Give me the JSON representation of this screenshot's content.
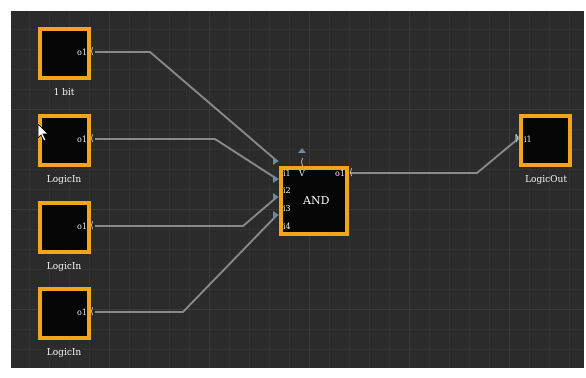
{
  "nodes": {
    "in1": {
      "caption": "1 bit",
      "output_port": "o1"
    },
    "in2": {
      "caption": "LogicIn",
      "output_port": "o1"
    },
    "in3": {
      "caption": "LogicIn",
      "output_port": "o1"
    },
    "in4": {
      "caption": "LogicIn",
      "output_port": "o1"
    },
    "and": {
      "title": "AND",
      "input_ports": [
        "i1",
        "i2",
        "i3",
        "i4"
      ],
      "output_port": "o1",
      "top_port": "V"
    },
    "out": {
      "caption": "LogicOut",
      "input_port": "i1"
    }
  },
  "colors": {
    "node_border": "#f2a51a",
    "canvas_bg": "#2b2b2b",
    "wire": "#8a8a8a"
  }
}
